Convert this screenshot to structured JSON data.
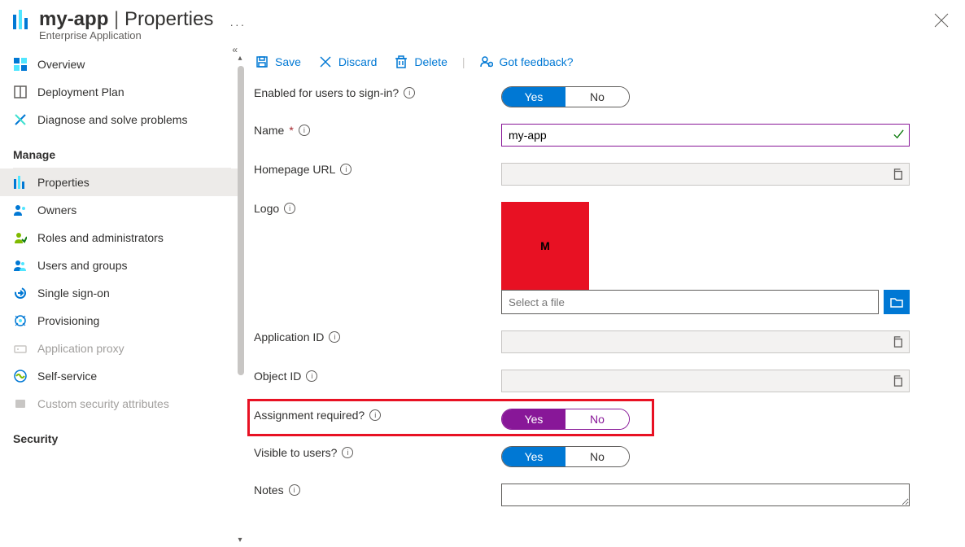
{
  "header": {
    "app_name": "my-app",
    "section": "Properties",
    "subtitle": "Enterprise Application"
  },
  "toolbar": {
    "save": "Save",
    "discard": "Discard",
    "delete": "Delete",
    "feedback": "Got feedback?"
  },
  "sidebar": {
    "items": [
      {
        "label": "Overview"
      },
      {
        "label": "Deployment Plan"
      },
      {
        "label": "Diagnose and solve problems"
      }
    ],
    "manage_heading": "Manage",
    "manage_items": [
      {
        "label": "Properties"
      },
      {
        "label": "Owners"
      },
      {
        "label": "Roles and administrators"
      },
      {
        "label": "Users and groups"
      },
      {
        "label": "Single sign-on"
      },
      {
        "label": "Provisioning"
      },
      {
        "label": "Application proxy"
      },
      {
        "label": "Self-service"
      },
      {
        "label": "Custom security attributes"
      }
    ],
    "security_heading": "Security"
  },
  "form": {
    "enabled_label": "Enabled for users to sign-in?",
    "name_label": "Name",
    "name_value": "my-app",
    "homepage_label": "Homepage URL",
    "logo_label": "Logo",
    "logo_letter": "M",
    "file_placeholder": "Select a file",
    "app_id_label": "Application ID",
    "object_id_label": "Object ID",
    "assignment_label": "Assignment required?",
    "visible_label": "Visible to users?",
    "notes_label": "Notes",
    "yes": "Yes",
    "no": "No"
  }
}
